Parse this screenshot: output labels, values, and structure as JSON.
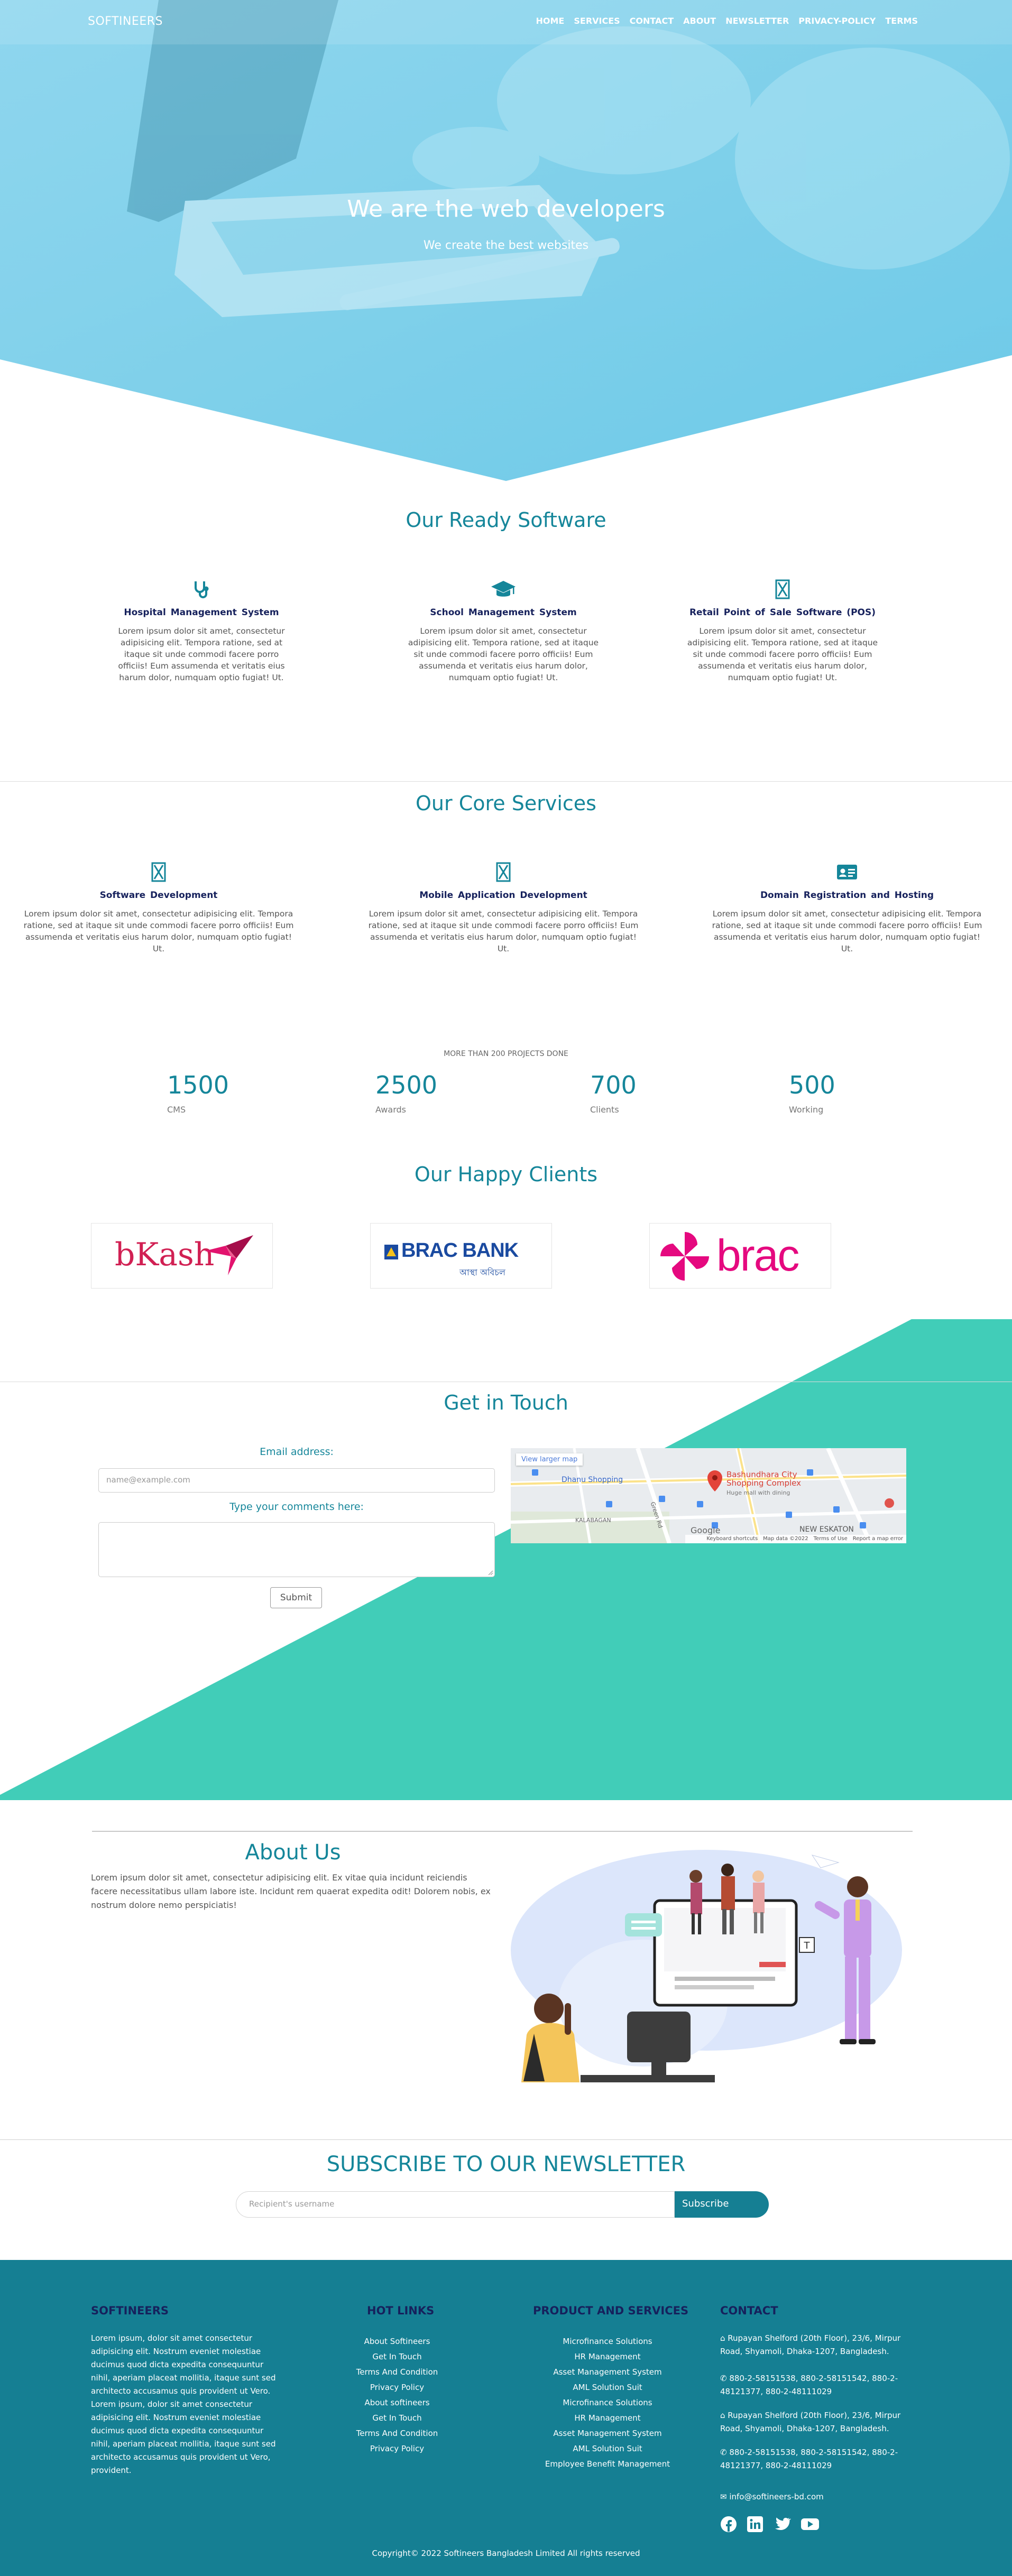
{
  "nav": {
    "brand": "SOFTINEERS",
    "links": [
      "HOME",
      "SERVICES",
      "CONTACT",
      "ABOUT",
      "NEWSLETTER",
      "PRIVACY-POLICY",
      "TERMS"
    ]
  },
  "hero": {
    "title": "We are the web developers",
    "subtitle": "We create the best websites"
  },
  "software": {
    "title": "Our Ready Software",
    "items": [
      {
        "icon": "stethoscope-icon",
        "title": "Hospital Management System",
        "text": "Lorem ipsum dolor sit amet, consectetur adipisicing elit. Tempora ratione, sed at itaque sit unde commodi facere porro officiis! Eum assumenda et veritatis eius harum dolor, numquam optio fugiat! Ut."
      },
      {
        "icon": "graduation-cap-icon",
        "title": "School Management System",
        "text": "Lorem ipsum dolor sit amet, consectetur adipisicing elit. Tempora ratione, sed at itaque sit unde commodi facere porro officiis! Eum assumenda et veritatis eius harum dolor, numquam optio fugiat! Ut."
      },
      {
        "icon": "hourglass-icon",
        "title": "Retail Point of Sale Software (POS)",
        "text": "Lorem ipsum dolor sit amet, consectetur adipisicing elit. Tempora ratione, sed at itaque sit unde commodi facere porro officiis! Eum assumenda et veritatis eius harum dolor, numquam optio fugiat! Ut."
      }
    ]
  },
  "services": {
    "title": "Our Core Services",
    "items": [
      {
        "icon": "hourglass-icon",
        "title": "Software Development",
        "text": "Lorem ipsum dolor sit amet, consectetur adipisicing elit. Tempora ratione, sed at itaque sit unde commodi facere porro officiis! Eum assumenda et veritatis eius harum dolor, numquam optio fugiat! Ut."
      },
      {
        "icon": "hourglass-icon",
        "title": "Mobile Application Development",
        "text": "Lorem ipsum dolor sit amet, consectetur adipisicing elit. Tempora ratione, sed at itaque sit unde commodi facere porro officiis! Eum assumenda et veritatis eius harum dolor, numquam optio fugiat! Ut."
      },
      {
        "icon": "id-card-icon",
        "title": "Domain Registration and Hosting",
        "text": "Lorem ipsum dolor sit amet, consectetur adipisicing elit. Tempora ratione, sed at itaque sit unde commodi facere porro officiis! Eum assumenda et veritatis eius harum dolor, numquam optio fugiat! Ut."
      }
    ]
  },
  "stats": {
    "caption": "MORE THAN 200 PROJECTS DONE",
    "items": [
      {
        "value": "1500",
        "label": "CMS"
      },
      {
        "value": "2500",
        "label": "Awards"
      },
      {
        "value": "700",
        "label": "Clients"
      },
      {
        "value": "500",
        "label": "Working"
      }
    ]
  },
  "clients": {
    "title": "Our Happy Clients",
    "logos": [
      "bKash",
      "BRAC BANK",
      "brac"
    ],
    "brac_bank_tagline": "আস্থা অবিচল"
  },
  "contact": {
    "title": "Get in Touch",
    "email_label": "Email address:",
    "email_placeholder": "name@example.com",
    "comments_label": "Type your comments here:",
    "submit": "Submit",
    "map": {
      "view_larger": "View larger map",
      "place_name": "Bashundhara City Shopping Complex",
      "place_note": "Huge mall with dining",
      "labels": [
        "Dhanu Shopping",
        "KALABAGAN",
        "NEW ESKATON",
        "Green Rd",
        "Google"
      ],
      "footer": [
        "Keyboard shortcuts",
        "Map data ©2022",
        "Terms of Use",
        "Report a map error"
      ]
    }
  },
  "about": {
    "title": "About Us",
    "text": "Lorem ipsum dolor sit amet, consectetur adipisicing elit. Ex vitae quia incidunt reiciendis facere necessitatibus ullam labore iste. Incidunt rem quaerat expedita odit! Dolorem nobis, ex nostrum dolore nemo perspiciatis!"
  },
  "newsletter": {
    "title": "SUBSCRIBE TO OUR NEWSLETTER",
    "placeholder": "Recipient's username",
    "button": "Subscribe"
  },
  "footer": {
    "brand_heading": "SOFTINEERS",
    "brand_text": "Lorem ipsum, dolor sit amet consectetur adipisicing elit. Nostrum eveniet molestiae ducimus quod dicta expedita consequuntur nihil, aperiam placeat mollitia, itaque sunt sed architecto accusamus quis provident ut Vero. Lorem ipsum, dolor sit amet consectetur adipisicing elit. Nostrum eveniet molestiae ducimus quod dicta expedita consequuntur nihil, aperiam placeat mollitia, itaque sunt sed architecto accusamus quis provident ut Vero, provident.",
    "hot_links_heading": "HOT LINKS",
    "hot_links": [
      "About Softineers",
      "Get In Touch",
      "Terms And Condition",
      "Privacy Policy",
      "About softineers",
      "Get In Touch",
      "Terms And Condition",
      "Privacy Policy"
    ],
    "products_heading": "PRODUCT AND SERVICES",
    "products": [
      "Microfinance Solutions",
      "HR Management",
      "Asset Management System",
      "AML Solution Suit",
      "Microfinance Solutions",
      "HR Management",
      "Asset Management System",
      "AML Solution Suit",
      "Employee Benefit Management"
    ],
    "contact_heading": "CONTACT",
    "address": "Rupayan Shelford (20th Floor), 23/6, Mirpur Road, Shyamoli, Dhaka-1207, Bangladesh.",
    "phones": "880-2-58151538, 880-2-58151542, 880-2-48121377, 880-2-48111029",
    "email": "info@softineers-bd.com",
    "social": [
      "facebook-icon",
      "linkedin-icon",
      "twitter-icon",
      "youtube-icon"
    ],
    "copyright": "Copyright© 2022 Softineers Bangladesh Limited All rights reserved"
  },
  "colors": {
    "teal": "#15869a",
    "footer_bg": "#157f93",
    "mint": "#41cdb8",
    "navy": "#16215c",
    "hero_blue": "#7fd2ec"
  }
}
